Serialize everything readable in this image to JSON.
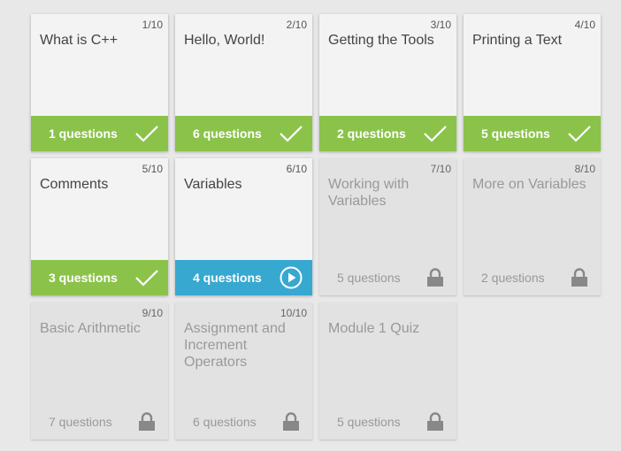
{
  "cards": [
    {
      "num": "1/10",
      "title": "What is C++",
      "questions": "1 questions",
      "status": "done",
      "icon": "check-icon"
    },
    {
      "num": "2/10",
      "title": "Hello, World!",
      "questions": "6 questions",
      "status": "done",
      "icon": "check-icon"
    },
    {
      "num": "3/10",
      "title": "Getting the Tools",
      "questions": "2 questions",
      "status": "done",
      "icon": "check-icon"
    },
    {
      "num": "4/10",
      "title": "Printing a Text",
      "questions": "5 questions",
      "status": "done",
      "icon": "check-icon"
    },
    {
      "num": "5/10",
      "title": "Comments",
      "questions": "3 questions",
      "status": "done",
      "icon": "check-icon"
    },
    {
      "num": "6/10",
      "title": "Variables",
      "questions": "4 questions",
      "status": "current",
      "icon": "play-icon"
    },
    {
      "num": "7/10",
      "title": "Working with Variables",
      "questions": "5 questions",
      "status": "locked",
      "icon": "lock-icon"
    },
    {
      "num": "8/10",
      "title": "More on Variables",
      "questions": "2 questions",
      "status": "locked",
      "icon": "lock-icon"
    },
    {
      "num": "9/10",
      "title": "Basic Arithmetic",
      "questions": "7 questions",
      "status": "locked",
      "icon": "lock-icon"
    },
    {
      "num": "10/10",
      "title": "Assignment and Increment Operators",
      "questions": "6 questions",
      "status": "locked",
      "icon": "lock-icon"
    },
    {
      "num": "",
      "title": "Module 1 Quiz",
      "questions": "5 questions",
      "status": "locked",
      "icon": "lock-icon"
    }
  ],
  "colors": {
    "done": "#8bc34a",
    "current": "#37a8d0",
    "locked_text": "#999999"
  }
}
